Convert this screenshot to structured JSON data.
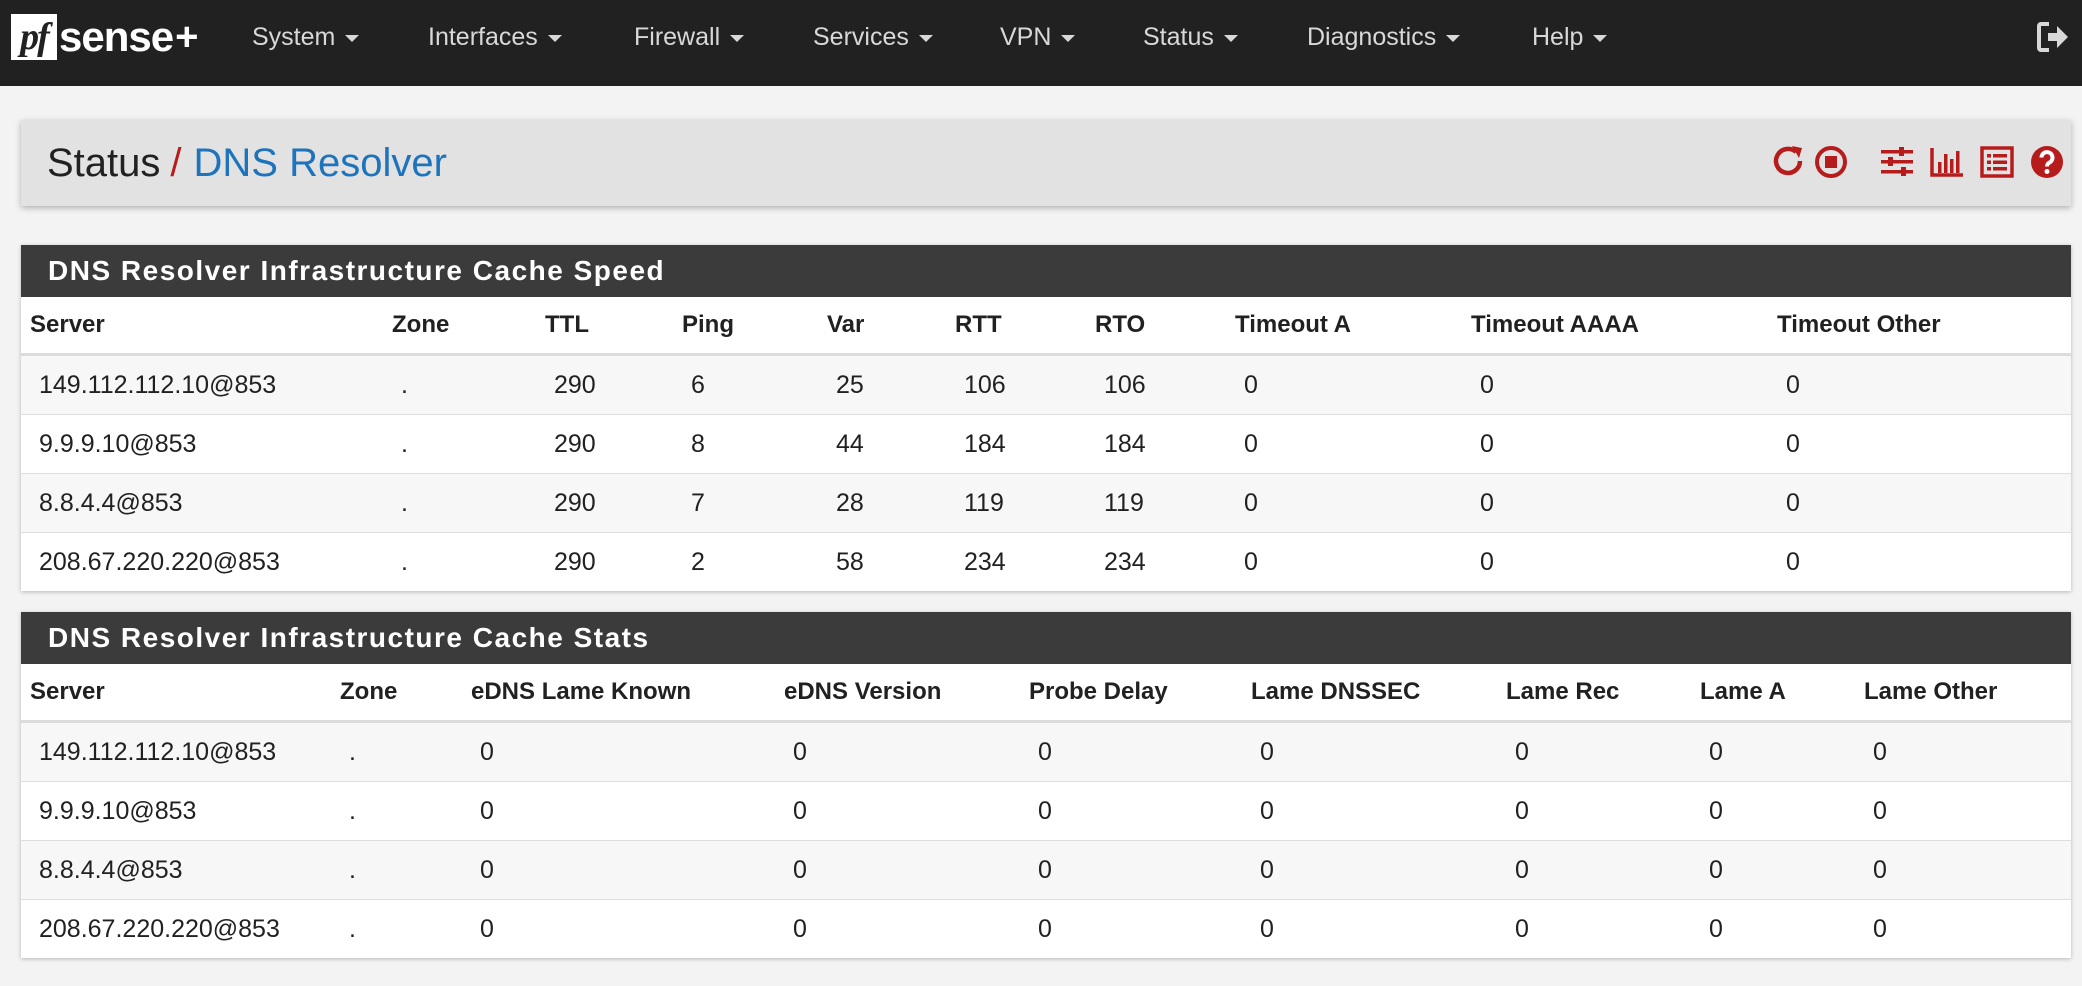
{
  "brand": {
    "pf": "pf",
    "sense": "sense",
    "plus": "+"
  },
  "nav": [
    "System",
    "Interfaces",
    "Firewall",
    "Services",
    "VPN",
    "Status",
    "Diagnostics",
    "Help"
  ],
  "breadcrumb": {
    "parent": "Status",
    "separator": "/",
    "current": "DNS Resolver"
  },
  "toolbar_icons": [
    "restart-icon",
    "stop-icon",
    "settings-sliders-icon",
    "bar-chart-icon",
    "log-list-icon",
    "help-icon"
  ],
  "accent_color": "#b71c1c",
  "link_color": "#1e74bc",
  "speed_panel": {
    "title": "DNS Resolver Infrastructure Cache Speed",
    "columns": [
      "Server",
      "Zone",
      "TTL",
      "Ping",
      "Var",
      "RTT",
      "RTO",
      "Timeout A",
      "Timeout AAAA",
      "Timeout Other"
    ],
    "rows": [
      [
        "149.112.112.10@853",
        ".",
        "290",
        "6",
        "25",
        "106",
        "106",
        "0",
        "0",
        "0"
      ],
      [
        "9.9.9.10@853",
        ".",
        "290",
        "8",
        "44",
        "184",
        "184",
        "0",
        "0",
        "0"
      ],
      [
        "8.8.4.4@853",
        ".",
        "290",
        "7",
        "28",
        "119",
        "119",
        "0",
        "0",
        "0"
      ],
      [
        "208.67.220.220@853",
        ".",
        "290",
        "2",
        "58",
        "234",
        "234",
        "0",
        "0",
        "0"
      ]
    ]
  },
  "stats_panel": {
    "title": "DNS Resolver Infrastructure Cache Stats",
    "columns": [
      "Server",
      "Zone",
      "eDNS Lame Known",
      "eDNS Version",
      "Probe Delay",
      "Lame DNSSEC",
      "Lame Rec",
      "Lame A",
      "Lame Other"
    ],
    "rows": [
      [
        "149.112.112.10@853",
        ".",
        "0",
        "0",
        "0",
        "0",
        "0",
        "0",
        "0"
      ],
      [
        "9.9.9.10@853",
        ".",
        "0",
        "0",
        "0",
        "0",
        "0",
        "0",
        "0"
      ],
      [
        "8.8.4.4@853",
        ".",
        "0",
        "0",
        "0",
        "0",
        "0",
        "0",
        "0"
      ],
      [
        "208.67.220.220@853",
        ".",
        "0",
        "0",
        "0",
        "0",
        "0",
        "0",
        "0"
      ]
    ]
  }
}
